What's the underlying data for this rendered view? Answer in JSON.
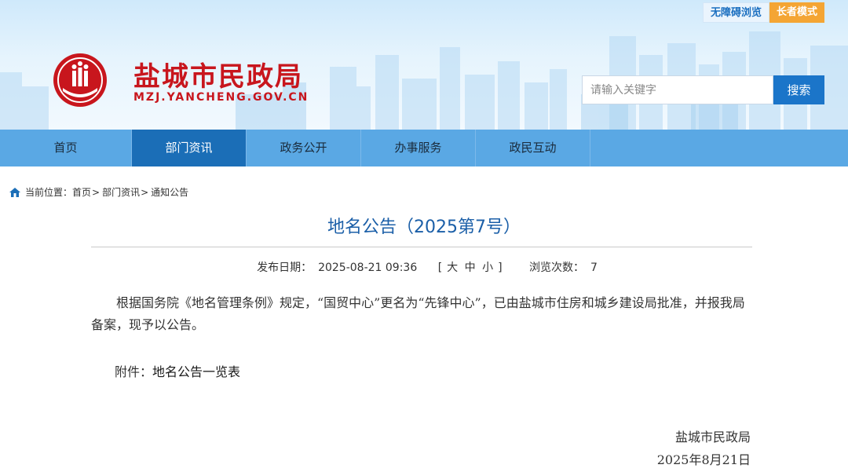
{
  "header": {
    "accessibility_label": "无障碍浏览",
    "elder_mode_label": "长者模式",
    "site_title": "盐城市民政局",
    "site_domain": "MZJ.YANCHENG.GOV.CN",
    "search": {
      "placeholder": "请输入关键字",
      "button_label": "搜索"
    }
  },
  "nav": {
    "items": [
      {
        "label": "首页"
      },
      {
        "label": "部门资讯"
      },
      {
        "label": "政务公开"
      },
      {
        "label": "办事服务"
      },
      {
        "label": "政民互动"
      }
    ],
    "active_index": 1
  },
  "breadcrumb": {
    "prefix": "当前位置：",
    "items": [
      "首页",
      "部门资讯",
      "通知公告"
    ],
    "separator": ">"
  },
  "article": {
    "title": "地名公告（2025第7号）",
    "publish_label": "发布日期：",
    "publish_date": "2025-08-21 09:36",
    "size_open": "[",
    "size_large": "大",
    "size_medium": "中",
    "size_small": "小",
    "size_close": "]",
    "views_label": "浏览次数：",
    "views": "7",
    "body": "根据国务院《地名管理条例》规定，“国贸中心”更名为“先锋中心”，已由盐城市住房和城乡建设局批准，并报我局备案，现予以公告。",
    "attachment_label": "附件：",
    "attachment_name": "地名公告一览表",
    "signature": "盐城市民政局",
    "sign_date": "2025年8月21日"
  },
  "colors": {
    "brand_red": "#c8161d",
    "nav_bg": "#5aa8e4",
    "nav_active": "#1b6eb7",
    "title_blue": "#1b5fa8",
    "search_button": "#1b75c9",
    "elder_mode": "#f4a534"
  }
}
